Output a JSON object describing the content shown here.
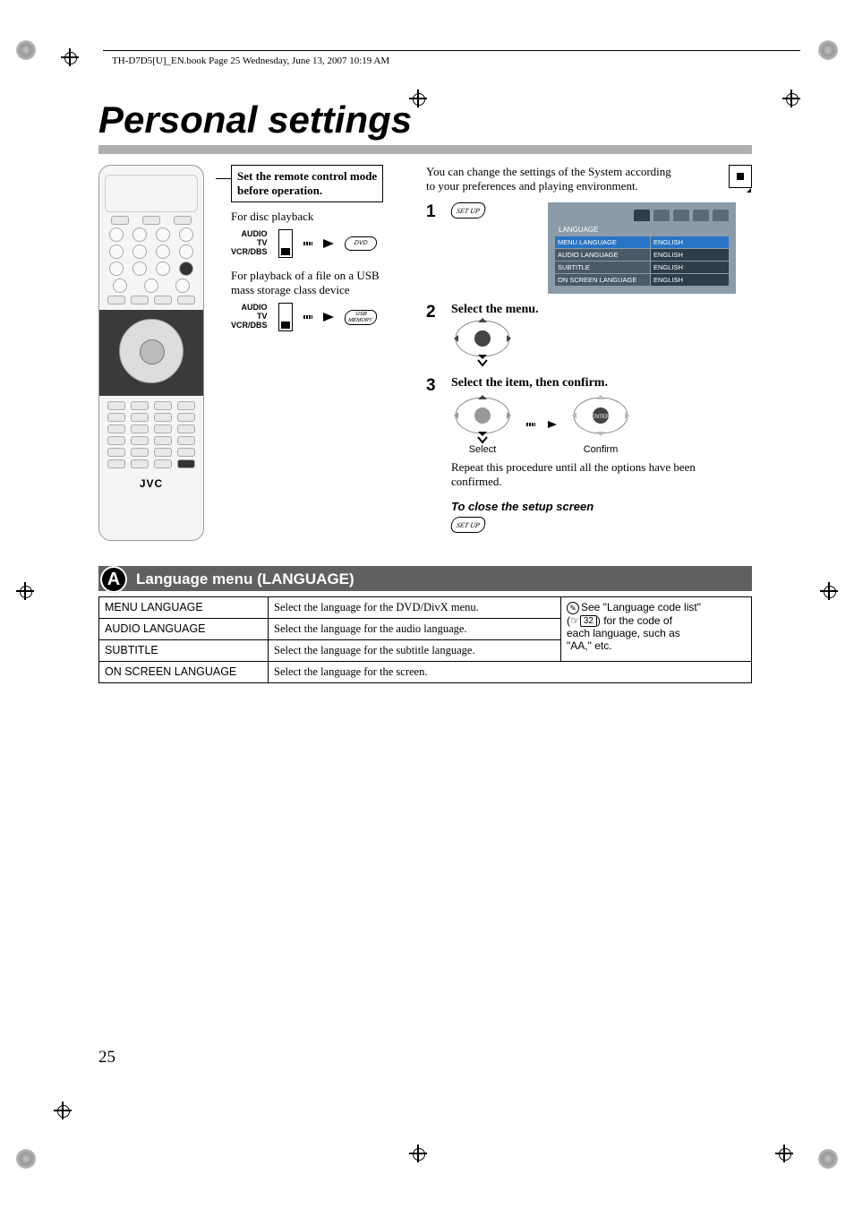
{
  "header": "TH-D7D5[U]_EN.book  Page 25  Wednesday, June 13, 2007  10:19 AM",
  "title": "Personal settings",
  "remote_brand": "JVC",
  "mid": {
    "box_title_1": "Set the remote control mode",
    "box_title_2": "before operation.",
    "disc": "For disc playback",
    "usb1": "For playback of a file on a USB",
    "usb2": "mass storage class device",
    "mode_audio": "AUDIO",
    "mode_tv": "TV",
    "mode_vcr": "VCR/DBS",
    "dvd_label": "DVD",
    "usb_label1": "USB",
    "usb_label2": "MEMORY"
  },
  "intro1": "You can change the settings of the System according",
  "intro2": "to your preferences and playing environment.",
  "steps": {
    "s1_num": "1",
    "setup_label": "SET UP",
    "s2_num": "2",
    "s2_title": "Select the menu.",
    "s3_num": "3",
    "s3_title": "Select the item, then confirm.",
    "select_cap": "Select",
    "confirm_cap": "Confirm",
    "repeat1": "Repeat this procedure until all the options have been",
    "repeat2": "confirmed.",
    "close_title": "To close the setup screen"
  },
  "osd": {
    "section": "LANGUAGE",
    "rows": [
      {
        "k": "MENU LANGUAGE",
        "v": "ENGLISH",
        "hl": true
      },
      {
        "k": "AUDIO LANGUAGE",
        "v": "ENGLISH",
        "hl": false
      },
      {
        "k": "SUBTITLE",
        "v": "ENGLISH",
        "hl": false
      },
      {
        "k": "ON SCREEN LANGUAGE",
        "v": "ENGLISH",
        "hl": false
      }
    ]
  },
  "section": {
    "badge": "A",
    "label": "Language menu (LANGUAGE)"
  },
  "table": {
    "rows": [
      {
        "k": "MENU LANGUAGE",
        "d": "Select the language for the DVD/DivX menu."
      },
      {
        "k": "AUDIO LANGUAGE",
        "d": "Select the language for the audio language."
      },
      {
        "k": "SUBTITLE",
        "d": "Select the language for the subtitle language."
      },
      {
        "k": "ON SCREEN LANGUAGE",
        "d": "Select the language for the screen."
      }
    ],
    "note1": "See \"Language code list\"",
    "note_pageref": "32",
    "note2a": "(",
    "note2b": ") for the code of",
    "note3": "each language, such as",
    "note4": "\"AA,\" etc."
  },
  "page_number": "25"
}
